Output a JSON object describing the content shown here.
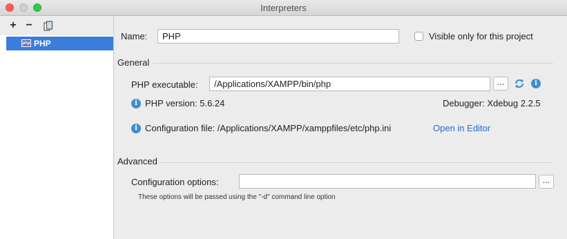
{
  "window": {
    "title": "Interpreters"
  },
  "toolbar": {
    "add": "+",
    "remove": "−"
  },
  "sidebar": {
    "items": [
      {
        "label": "PHP",
        "badge": "php"
      }
    ]
  },
  "form": {
    "name_label": "Name:",
    "name_value": "PHP",
    "visible_only_label": "Visible only for this project",
    "visible_only_checked": false
  },
  "general": {
    "title": "General",
    "executable_label": "PHP executable:",
    "executable_value": "/Applications/XAMPP/bin/php",
    "browse": "...",
    "php_version": "PHP version: 5.6.24",
    "debugger": "Debugger: Xdebug 2.2.5",
    "config_file": "Configuration file: /Applications/XAMPP/xamppfiles/etc/php.ini",
    "open_in_editor": "Open in Editor"
  },
  "advanced": {
    "title": "Advanced",
    "options_label": "Configuration options:",
    "options_value": "",
    "browse": "...",
    "hint": "These options will be passed using the \"-d\" command line option"
  },
  "colors": {
    "selection": "#3b7ddb",
    "link": "#2968c7",
    "info": "#3e8ed0"
  },
  "icons": [
    "add-icon",
    "remove-icon",
    "copy-icon",
    "php-icon",
    "refresh-icon",
    "info-icon"
  ]
}
